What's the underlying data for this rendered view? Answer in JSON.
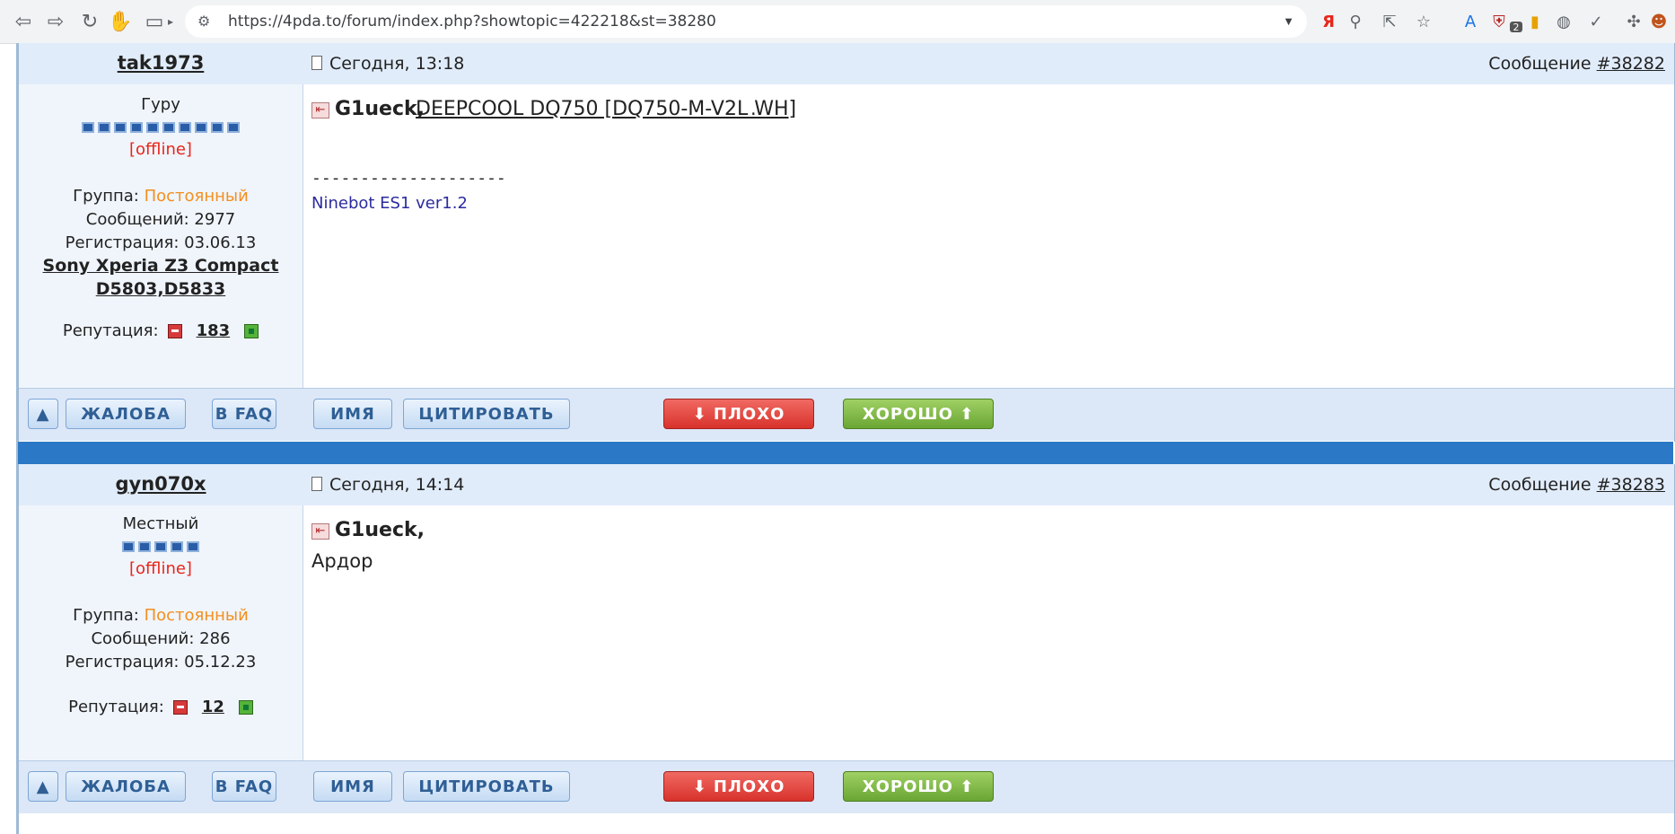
{
  "browser": {
    "url": "https://4pda.to/forum/index.php?showtopic=422218&st=38280",
    "extension_badge": "2",
    "icons": [
      "back-icon",
      "forward-icon",
      "reload-icon",
      "extension-icon",
      "sidebar-icon",
      "tune-icon",
      "yandex-icon",
      "zoom-icon",
      "share-icon",
      "star-icon",
      "translate-icon",
      "shield-icon",
      "bookmark-icon",
      "globe-icon",
      "check-shield-icon",
      "puzzle-icon"
    ]
  },
  "posts": [
    {
      "username": "tak1973",
      "date": "Сегодня, 13:18",
      "number_label": "Сообщение",
      "number": "#38282",
      "rank": "Гуру",
      "status": "[offline]",
      "group_label": "Группа:",
      "group": "Постоянный",
      "messages": "Сообщений: 2977",
      "registration": "Регистрация: 03.06.13",
      "device_line1": "Sony Xperia Z3 Compact",
      "device_line2": "D5803,D5833",
      "rep_label": "Репутация:",
      "rep": "183",
      "reply_to": "G1ueck,",
      "link": "DEEPCOOL DQ750 [DQ750-M-V2L WH]",
      "tail": ".",
      "sig_divider": "--------------------",
      "signature": "Ninebot ES1 ver1.2"
    },
    {
      "username": "gyn070x",
      "date": "Сегодня, 14:14",
      "number_label": "Сообщение",
      "number": "#38283",
      "rank": "Местный",
      "status": "[offline]",
      "group_label": "Группа:",
      "group": "Постоянный",
      "messages": "Сообщений: 286",
      "registration": "Регистрация: 05.12.23",
      "rep_label": "Репутация:",
      "rep": "12",
      "reply_to": "G1ueck,",
      "text": "Ардор"
    }
  ],
  "buttons": {
    "up": "▲",
    "complaint": "ЖАЛОБА",
    "faq": "В FAQ",
    "name": "ИМЯ",
    "quote": "ЦИТИРОВАТЬ",
    "bad": "⬇ ПЛОХО",
    "good": "ХОРОШО ⬆"
  }
}
